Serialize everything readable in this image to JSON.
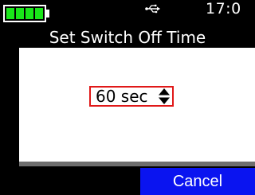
{
  "status_bar": {
    "battery_icon": "battery-full-icon",
    "battery_level": 1.0,
    "battery_color": "#19e619",
    "usb_icon": "usb-icon",
    "time": "17:0"
  },
  "dialog": {
    "title": "Set Switch Off Time",
    "value": "60 sec",
    "spinner_icon": "up-down-arrows-icon",
    "highlight_color": "#e01818"
  },
  "buttons": {
    "cancel_label": "Cancel",
    "cancel_color": "#0a14f0"
  }
}
